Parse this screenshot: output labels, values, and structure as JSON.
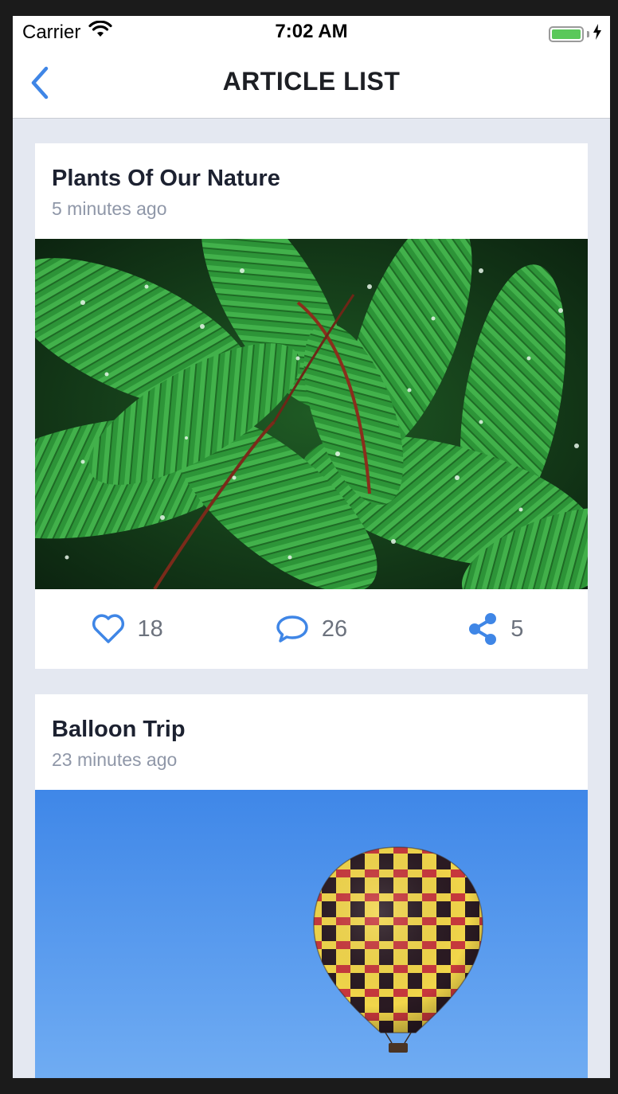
{
  "status_bar": {
    "carrier": "Carrier",
    "time": "7:02 AM",
    "wifi_icon": "wifi-icon",
    "battery_icon": "battery-icon",
    "charging_icon": "bolt-icon"
  },
  "navbar": {
    "title": "ARTICLE LIST",
    "back_icon": "chevron-left-icon"
  },
  "colors": {
    "accent": "#3f86e6",
    "background": "#e4e8f1",
    "card": "#ffffff",
    "title_text": "#1c2130",
    "meta_text": "#8f97a8"
  },
  "articles": [
    {
      "title": "Plants Of Our Nature",
      "time": "5 minutes ago",
      "image": "fern-leaves-photo",
      "likes": "18",
      "comments": "26",
      "shares": "5"
    },
    {
      "title": "Balloon Trip",
      "time": "23 minutes ago",
      "image": "hot-air-balloon-photo"
    }
  ]
}
